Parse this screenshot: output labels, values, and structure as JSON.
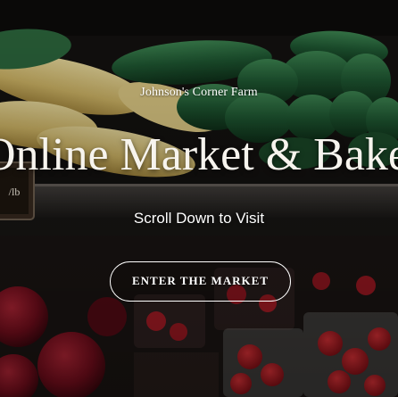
{
  "hero": {
    "farm_name": "Johnson's Corner Farm",
    "headline": "Online Market & Bakery",
    "subhead": "Scroll Down to Visit",
    "cta_label": "ENTER THE MARKET"
  },
  "shelf_sign": {
    "price_text": "/lb"
  }
}
